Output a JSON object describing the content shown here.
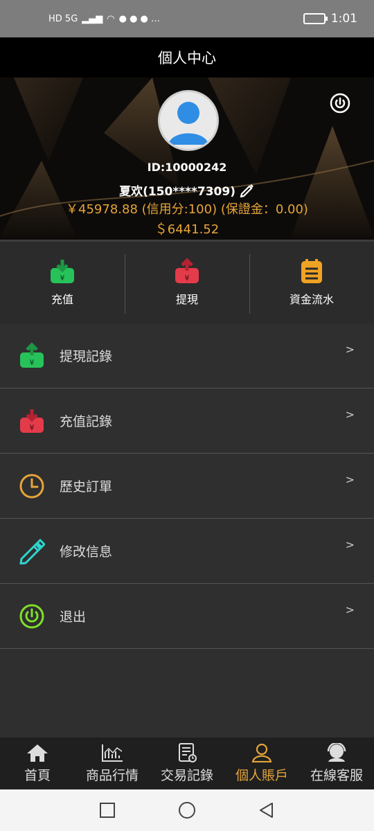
{
  "status_bar": {
    "indicators": "HD 5G",
    "time": "1:01"
  },
  "header": {
    "title": "個人中心"
  },
  "profile": {
    "id": "ID:10000242",
    "name": "夏欢(150****7309)",
    "balance_line": "￥45978.88 (信用分:100) (保證金：0.00)",
    "usd_line": "＄6441.52"
  },
  "actions": [
    {
      "label": "充值",
      "icon": "deposit-icon",
      "color": "#27c35a"
    },
    {
      "label": "提現",
      "icon": "withdraw-icon",
      "color": "#e33b4a"
    },
    {
      "label": "資金流水",
      "icon": "ledger-icon",
      "color": "#f0a323"
    }
  ],
  "menu": [
    {
      "label": "提現記錄",
      "icon": "withdraw-record-icon",
      "arrow": ">"
    },
    {
      "label": "充值記錄",
      "icon": "deposit-record-icon",
      "arrow": ">"
    },
    {
      "label": "歷史訂單",
      "icon": "clock-icon",
      "arrow": ">"
    },
    {
      "label": "修改信息",
      "icon": "pencil-icon",
      "arrow": ">"
    },
    {
      "label": "退出",
      "icon": "power-icon",
      "arrow": ">"
    }
  ],
  "tabbar": [
    {
      "label": "首頁",
      "icon": "home-icon"
    },
    {
      "label": "商品行情",
      "icon": "chart-icon"
    },
    {
      "label": "交易記錄",
      "icon": "document-icon"
    },
    {
      "label": "個人賬戶",
      "icon": "user-icon",
      "active": true
    },
    {
      "label": "在線客服",
      "icon": "support-icon"
    }
  ],
  "colors": {
    "accent": "#e6a53a",
    "bg": "#2f2f2f",
    "header": "#000000"
  }
}
